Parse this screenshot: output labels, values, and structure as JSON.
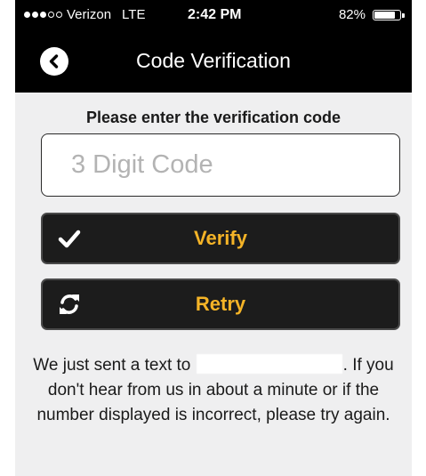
{
  "status_bar": {
    "carrier": "Verizon",
    "network": "LTE",
    "time": "2:42 PM",
    "battery_percent": "82%",
    "battery_level": 0.82,
    "signal_bars_filled": 3,
    "signal_bars_total": 5
  },
  "nav": {
    "title": "Code Verification",
    "back_icon": "chevron-left-circle-icon"
  },
  "form": {
    "prompt": "Please enter the verification code",
    "code_placeholder": "3 Digit Code",
    "code_value": ""
  },
  "buttons": {
    "verify_label": "Verify",
    "verify_icon": "checkmark-icon",
    "retry_label": "Retry",
    "retry_icon": "refresh-icon"
  },
  "message": {
    "prefix": "We just sent a text to",
    "suffix": ". If you don't hear from us in about a minute or if the number displayed is incorrect, please try again."
  },
  "colors": {
    "accent": "#f5b427",
    "bar_background": "#000000",
    "content_background": "#efeff0",
    "button_background": "#1c1c1c"
  }
}
